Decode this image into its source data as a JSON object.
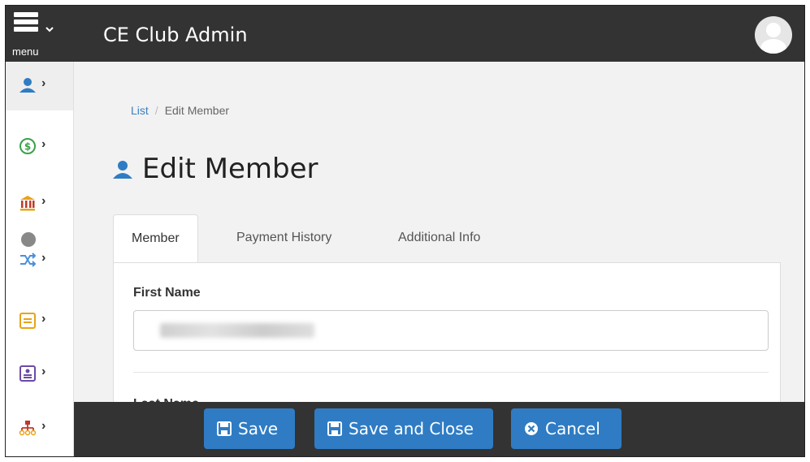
{
  "header": {
    "menu_label": "menu",
    "app_title": "CE Club Admin"
  },
  "sidebar": {
    "items": [
      {
        "icon": "member-icon",
        "chevron": "›",
        "active": true
      },
      {
        "icon": "dollar-circle-icon",
        "chevron": "›"
      },
      {
        "icon": "bank-icon",
        "chevron": "›"
      },
      {
        "icon": "shuffle-icon",
        "chevron": "›"
      },
      {
        "icon": "list-icon",
        "chevron": "›"
      },
      {
        "icon": "report-icon",
        "chevron": "›"
      },
      {
        "icon": "org-chart-icon",
        "chevron": "›"
      }
    ]
  },
  "breadcrumb": {
    "root": "List",
    "separator": "/",
    "current": "Edit Member"
  },
  "page": {
    "title": "Edit Member"
  },
  "tabs": [
    {
      "label": "Member",
      "active": true
    },
    {
      "label": "Payment History"
    },
    {
      "label": "Additional Info"
    }
  ],
  "form": {
    "first_name_label": "First Name",
    "first_name_value": "",
    "last_name_label": "Last Name"
  },
  "actions": {
    "save_label": "Save",
    "save_close_label": "Save and Close",
    "cancel_label": "Cancel"
  },
  "colors": {
    "accent": "#2f7cc4",
    "topbar": "#333333",
    "icon_blue": "#2f7cc4",
    "icon_green": "#3aa14a",
    "icon_orange": "#e8a317",
    "icon_purple": "#6b4aa8",
    "icon_red": "#c0392b"
  }
}
